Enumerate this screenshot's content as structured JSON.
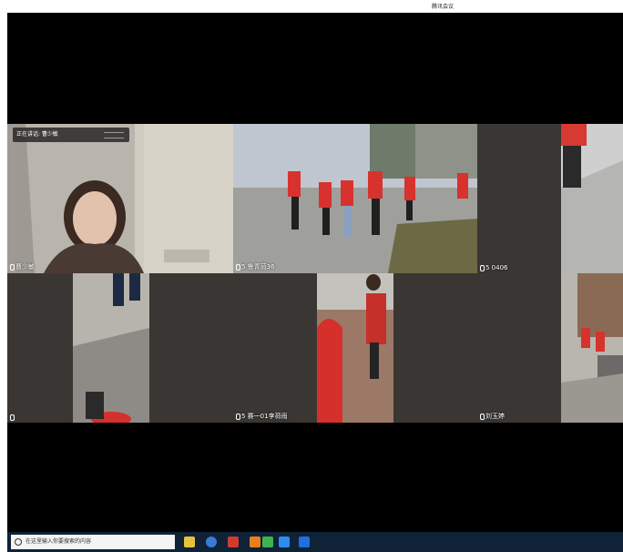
{
  "window": {
    "title": "腾讯会议"
  },
  "speaking": {
    "label": "正在讲话: 曹少敏"
  },
  "tiles": [
    {
      "name": "曹少敏"
    },
    {
      "name": "5 鲁青荷36"
    },
    {
      "name": "5 0406"
    },
    {
      "name": ""
    },
    {
      "name": "5 赛一01李荷雨"
    },
    {
      "name": "刘玉婷"
    }
  ],
  "taskbar": {
    "search_placeholder": "在这里输入你要搜索的内容",
    "icons": [
      "task-view-icon",
      "file-explorer-icon",
      "browser-icon",
      "antivirus-icon",
      "wechat-icon",
      "cloud-icon",
      "tencent-meeting-icon"
    ]
  },
  "colors": {
    "meeting_bg": "#000000",
    "tile_bg": "#3a3633",
    "taskbar_bg": "#0f2236"
  }
}
